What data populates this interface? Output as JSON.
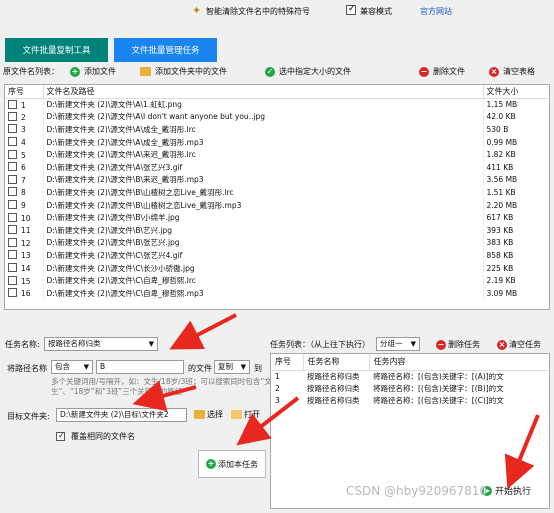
{
  "topbar": {
    "title": "智能清除文件名中的特殊符号",
    "compat_label": "兼容模式",
    "site_label": "官方网站"
  },
  "mode_buttons": {
    "copy": "文件批量复制工具",
    "manage": "文件批量管理任务"
  },
  "toolbar": {
    "list_label": "原文件名列表：",
    "add_file": "添加文件",
    "add_folder_files": "添加文件夹中的文件",
    "select_size": "选中指定大小的文件",
    "delete_file": "删除文件",
    "clear_table": "清空表格"
  },
  "file_table": {
    "headers": [
      "序号",
      "文件名及路径",
      "文件大小"
    ],
    "rows": [
      {
        "no": "1",
        "path": "D:\\新建文件夹 (2)\\源文件\\A\\1.虹虹.png",
        "size": "1.15 MB"
      },
      {
        "no": "2",
        "path": "D:\\新建文件夹 (2)\\源文件\\A\\I don't want anyone but you..jpg",
        "size": "42.0 KB"
      },
      {
        "no": "3",
        "path": "D:\\新建文件夹 (2)\\源文件\\A\\成全_戴羽彤.lrc",
        "size": "530 B"
      },
      {
        "no": "4",
        "path": "D:\\新建文件夹 (2)\\源文件\\A\\成全_戴羽彤.mp3",
        "size": "0.99 MB"
      },
      {
        "no": "5",
        "path": "D:\\新建文件夹 (2)\\源文件\\A\\来迟_戴羽彤.lrc",
        "size": "1.82 KB"
      },
      {
        "no": "6",
        "path": "D:\\新建文件夹 (2)\\源文件\\A\\张艺兴3.gif",
        "size": "411 KB"
      },
      {
        "no": "7",
        "path": "D:\\新建文件夹 (2)\\源文件\\B\\来迟_戴羽彤.mp3",
        "size": "3.56 MB"
      },
      {
        "no": "8",
        "path": "D:\\新建文件夹 (2)\\源文件\\B\\山楂树之恋Live_戴羽彤.lrc",
        "size": "1.51 KB"
      },
      {
        "no": "9",
        "path": "D:\\新建文件夹 (2)\\源文件\\B\\山楂树之恋Live_戴羽彤.mp3",
        "size": "2.20 MB"
      },
      {
        "no": "10",
        "path": "D:\\新建文件夹 (2)\\源文件\\B\\小绵羊.jpg",
        "size": "617 KB"
      },
      {
        "no": "11",
        "path": "D:\\新建文件夹 (2)\\源文件\\B\\艺兴.jpg",
        "size": "393 KB"
      },
      {
        "no": "12",
        "path": "D:\\新建文件夹 (2)\\源文件\\B\\张艺兴.jpg",
        "size": "383 KB"
      },
      {
        "no": "13",
        "path": "D:\\新建文件夹 (2)\\源文件\\C\\张艺兴4.gif",
        "size": "858 KB"
      },
      {
        "no": "14",
        "path": "D:\\新建文件夹 (2)\\源文件\\C\\长沙小骄傲.jpg",
        "size": "225 KB"
      },
      {
        "no": "15",
        "path": "D:\\新建文件夹 (2)\\源文件\\C\\自卑_穆哲熙.lrc",
        "size": "2.19 KB"
      },
      {
        "no": "16",
        "path": "D:\\新建文件夹 (2)\\源文件\\C\\自卑_穆哲熙.mp3",
        "size": "3.09 MB"
      }
    ]
  },
  "task_form": {
    "task_name_label": "任务名称:",
    "task_name_value": "按路径名称归类",
    "rule_label": "将路径名称",
    "rule_mode": "包含",
    "keyword": "B",
    "file_label": "的文件",
    "action": "复制",
    "to_label": "到",
    "hint": "多个关键词用/号隔开，如：文生/18岁/3班；可以搜索同时包含“文生”、“18岁”和“3班”三个关键词的路径",
    "target_label": "目标文件夹:",
    "target_value": "D:\\新建文件夹 (2)\\目标\\文件夹2",
    "select_btn": "选择",
    "open_btn": "打开",
    "overwrite_label": "覆盖相同的文件名",
    "add_task_btn": "添加本任务"
  },
  "task_list": {
    "label": "任务列表：（从上往下执行）",
    "group_value": "分组一",
    "delete_task": "删除任务",
    "clear_tasks": "清空任务",
    "headers": [
      "序号",
      "任务名称",
      "任务内容"
    ],
    "rows": [
      {
        "no": "1",
        "name": "按路径名称归类",
        "content": "将路径名称：[(包含)关键字：[(A)]的文"
      },
      {
        "no": "2",
        "name": "按路径名称归类",
        "content": "将路径名称：[(包含)关键字：[(B)]的文"
      },
      {
        "no": "3",
        "name": "按路径名称归类",
        "content": "将路径名称：[(包含)关键字：[(C)]的文"
      }
    ],
    "start_btn": "开始执行"
  },
  "watermark": "CSDN @hby920967810",
  "colors": {
    "mode_copy_bg": "#00837b",
    "mode_manage_bg": "#1a84f0",
    "arrow": "#e8281e"
  }
}
